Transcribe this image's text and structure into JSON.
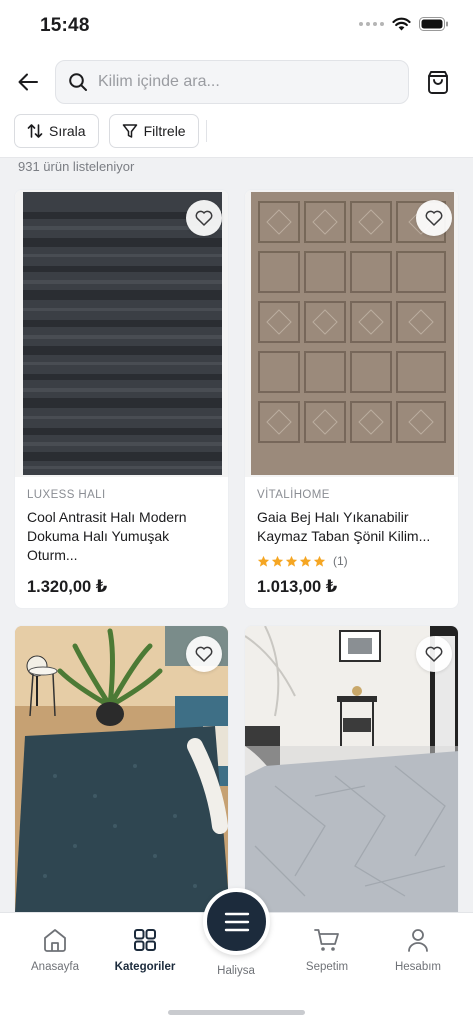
{
  "status_bar": {
    "time": "15:48"
  },
  "header": {
    "search_placeholder": "Kilim içinde ara...",
    "sort_label": "Sırala",
    "filter_label": "Filtrele"
  },
  "results": {
    "count_text": "931 ürün listeleniyor"
  },
  "products": [
    {
      "brand": "LUXESS HALI",
      "title": "Cool Antrasit Halı Modern Dokuma Halı Yumuşak Oturm...",
      "price": "1.320,00 ₺",
      "rating_stars": null,
      "rating_count": ""
    },
    {
      "brand": "VİTALİHOME",
      "title": "Gaia Bej Halı Yıkanabilir Kaymaz Taban Şönil Kilim...",
      "price": "1.013,00 ₺",
      "rating_stars": 5,
      "rating_count": "(1)"
    },
    {
      "brand": "",
      "title": "",
      "price": "",
      "rating_stars": null,
      "rating_count": ""
    },
    {
      "brand": "",
      "title": "",
      "price": "",
      "rating_stars": null,
      "rating_count": ""
    }
  ],
  "tabbar": {
    "home": "Anasayfa",
    "categories": "Kategoriler",
    "center": "Haliysa",
    "cart": "Sepetim",
    "account": "Hesabım",
    "active_tab": "categories"
  },
  "colors": {
    "accent_dark": "#1c2b3c",
    "star": "#f5a623",
    "rug_1": "#3a3e44",
    "rug_2": "#9a8878",
    "rug_3": "#2f4651",
    "rug_4": "#b7bcc3"
  }
}
